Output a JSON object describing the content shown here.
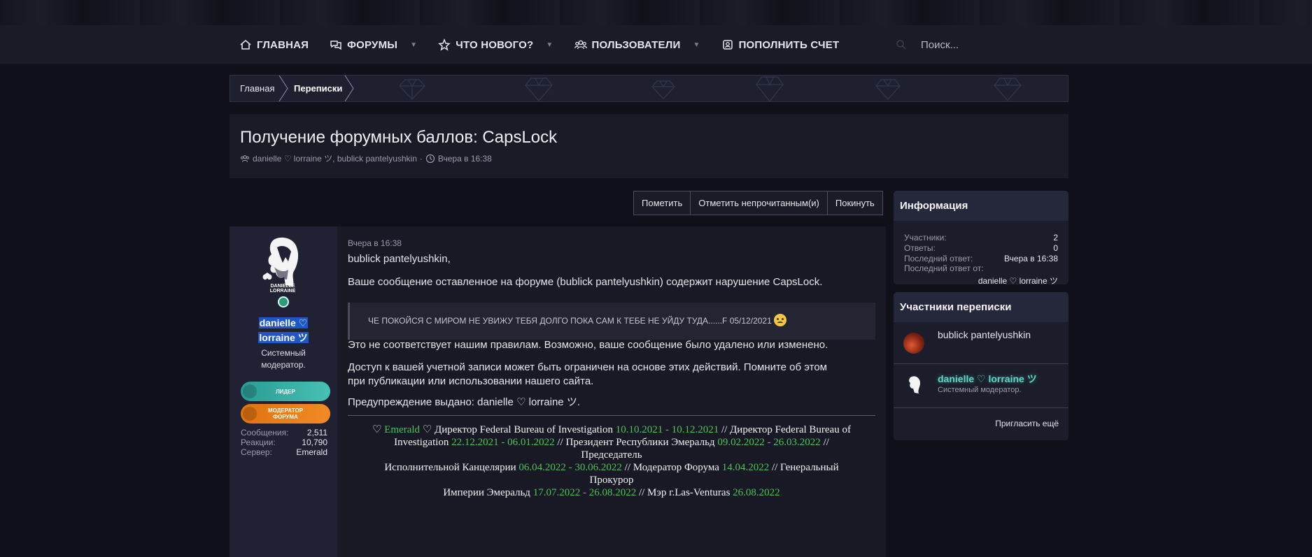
{
  "nav": {
    "items": [
      {
        "label": "ГЛАВНАЯ",
        "icon": "home-icon",
        "has_menu": false
      },
      {
        "label": "ФОРУМЫ",
        "icon": "comments-icon",
        "has_menu": true
      },
      {
        "label": "ЧТО НОВОГО?",
        "icon": "star-icon",
        "has_menu": true
      },
      {
        "label": "ПОЛЬЗОВАТЕЛИ",
        "icon": "users-icon",
        "has_menu": true
      },
      {
        "label": "ПОПОЛНИТЬ СЧЕТ",
        "icon": "wallet-icon",
        "has_menu": false
      }
    ],
    "search_placeholder": "Поиск..."
  },
  "breadcrumb": [
    "Главная",
    "Переписки"
  ],
  "thread": {
    "title": "Получение форумных баллов: CapsLock",
    "participants": "danielle ♡ lorraine ツ, bublick pantelyushkin",
    "separator": "·",
    "time": "Вчера в 16:38"
  },
  "actions": [
    "Пометить",
    "Отметить непрочитанным(и)",
    "Покинуть"
  ],
  "post": {
    "author": {
      "name_line1": "danielle ♡",
      "name_line2": "lorraine ツ",
      "title_line1": "Системный",
      "title_line2": "модератор.",
      "avatar_text_1": "DANIELLE",
      "avatar_text_2": "LORRAINE",
      "badges": [
        {
          "label_1": "ЛИДЕР",
          "label_2": "",
          "color": "#3cb2a8"
        },
        {
          "label_1": "МОДЕРАТОР",
          "label_2": "ФОРУМА",
          "color": "#ec7f1a"
        }
      ],
      "stats": [
        {
          "label": "Сообщения:",
          "value": "2,511"
        },
        {
          "label": "Реакции:",
          "value": "10,790"
        },
        {
          "label": "Сервер:",
          "value": "Emerald"
        }
      ]
    },
    "date": "Вчера в 16:38",
    "greeting": "bublick pantelyushkin,",
    "violation_text": "Ваше сообщение оставленное на форуме (bublick pantelyushkin) содержит нарушение CapsLock.",
    "quote": "ЧЕ ПОКОЙСЯ С МИРОМ НЕ УВИЖУ ТЕБЯ ДОЛГО ПОКА САМ К ТЕБЕ НЕ УЙДУ ТУДА......F 05/12/2021",
    "rules_text": "Это не соответствует нашим правилам. Возможно, ваше сообщение было удалено или изменено.",
    "access_text_line1": "Доступ к вашей учетной записи может быть ограничен на основе этих действий. Помните об этом",
    "access_text_line2": "при публикации или использовании нашего сайта.",
    "warning_text": "Предупреждение выдано: danielle ♡ lorraine ツ.",
    "signature": {
      "l1_a": "♡ ",
      "l1_g": "Emerald",
      "l1_b": " ♡ Директор Federal Bureau of Investigation ",
      "l1_d": "10.10.2021 - 10.12.2021",
      "l1_c": " // Директор Federal Bureau of",
      "l2_a": "Investigation ",
      "l2_d": "22.12.2021 - 06.01.2022",
      "l2_b": " // Президент Республики Эмеральд ",
      "l2_d2": "09.02.2022 - 26.03.2022",
      "l2_c": " //",
      "l3": "Председатель",
      "l4_a": "Исполнительной Канцелярии ",
      "l4_d": "06.04.2022 - 30.06.2022",
      "l4_b": " // Модератор Форума ",
      "l4_d2": "14.04.2022",
      "l4_c": " // Генеральный",
      "l5": "Прокурор",
      "l6_a": "Империи Эмеральд ",
      "l6_d": "17.07.2022 - 26.08.2022",
      "l6_b": " // Мэр г.Las-Venturas ",
      "l6_d2": "26.08.2022"
    }
  },
  "sidebar": {
    "info": {
      "title": "Информация",
      "rows": [
        {
          "label": "Участники:",
          "value": "2"
        },
        {
          "label": "Ответы:",
          "value": "0"
        },
        {
          "label": "Последний ответ:",
          "value": "Вчера в 16:38"
        },
        {
          "label": "Последний ответ от:",
          "value": ""
        }
      ],
      "last_by": "danielle ♡ lorraine ツ"
    },
    "participants": {
      "title": "Участники переписки",
      "list": [
        {
          "name": "bublick pantelyushkin",
          "subtitle": ""
        },
        {
          "name": "danielle ♡ lorraine ツ",
          "subtitle": "Системный модератор."
        }
      ],
      "invite_label": "Пригласить ещё"
    }
  },
  "colors": {
    "background": "#0f101a",
    "navbar": "#1a1b27",
    "accent_green": "#4ec25a",
    "username_highlight": "#1f58c6",
    "leader_badge": "#3cb2a8",
    "moderator_badge": "#ec7f1a"
  }
}
